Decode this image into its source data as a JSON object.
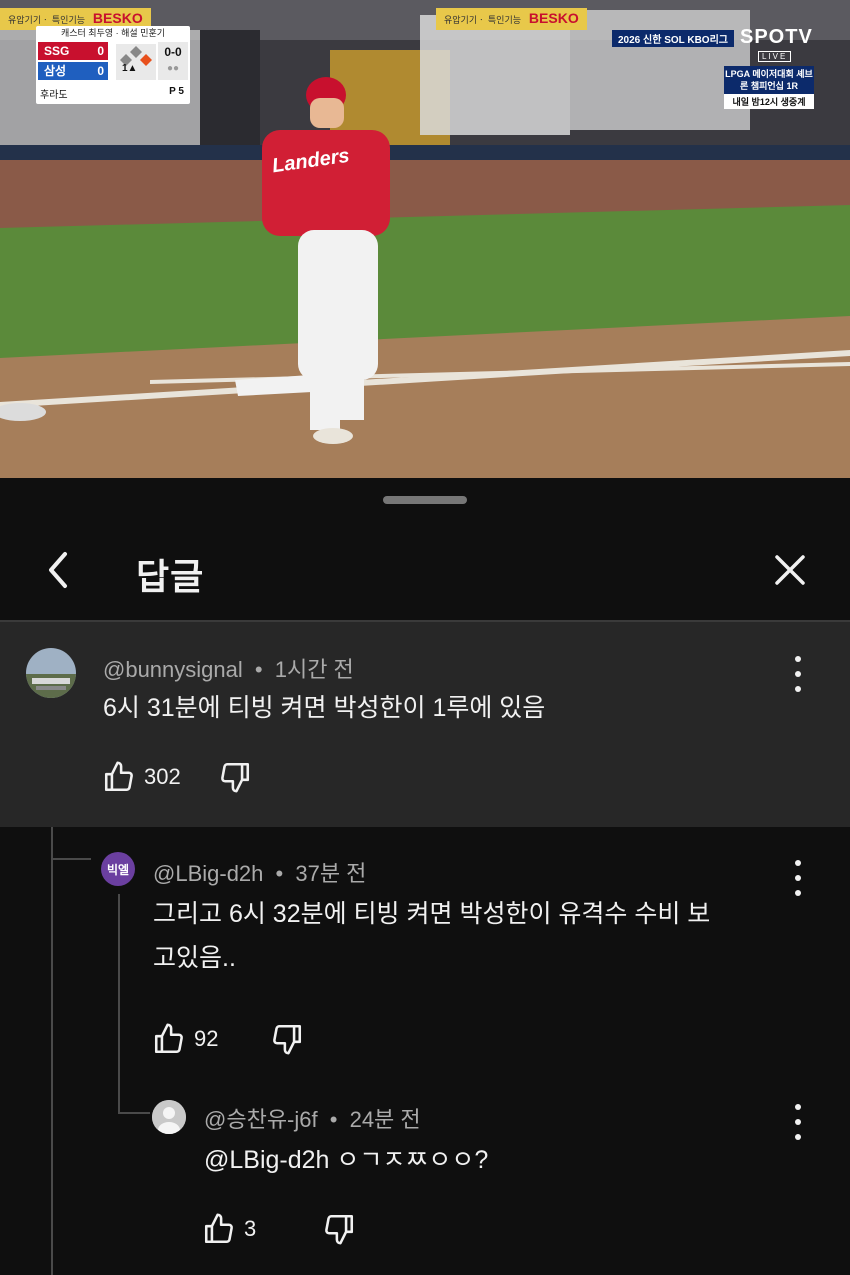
{
  "video": {
    "banner_left": {
      "small": "유압기기ㆍ 특인기능",
      "brand": "BESKO"
    },
    "banner_right": {
      "small": "유압기기ㆍ 특인기능",
      "brand": "BESKO"
    },
    "scoreboard": {
      "caster": "캐스터 최두영 · 해설 민훈기",
      "team_away": "SSG",
      "score_away": "0",
      "team_home": "삼성",
      "score_home": "0",
      "count": "0-0",
      "inning": "1▲",
      "batter": "후라도",
      "pitch": "P  5"
    },
    "broadcast": {
      "league": "2026 신한 SOL KBO리그",
      "network": "SPOTV",
      "live": "LIVE",
      "promo": "LPGA 메이저대회 셰브론 챔피언십 1R",
      "promo_time": "내일 밤12시 생중계"
    },
    "jersey_text": "Landers"
  },
  "sheet": {
    "title": "답글",
    "comments": [
      {
        "handle": "@bunnysignal",
        "time": "1시간 전",
        "text": "6시 31분에 티빙 켜면 박성한이 1루에 있음",
        "likes": "302"
      },
      {
        "handle": "@LBig-d2h",
        "time": "37분 전",
        "avatar_text": "빅엘",
        "text_line1": "그리고 6시 32분에 티빙 켜면 박성한이 유격수 수비 보",
        "text_line2": "고있음..",
        "likes": "92"
      },
      {
        "handle": "@승찬유-j6f",
        "time": "24분 전",
        "text": "@LBig-d2h ㅇㄱㅈㅉㅇㅇ?",
        "likes": "3"
      }
    ]
  },
  "colors": {
    "background": "#0f0f0f",
    "highlight": "#272727",
    "avatar_purple": "#6b3fa0"
  }
}
